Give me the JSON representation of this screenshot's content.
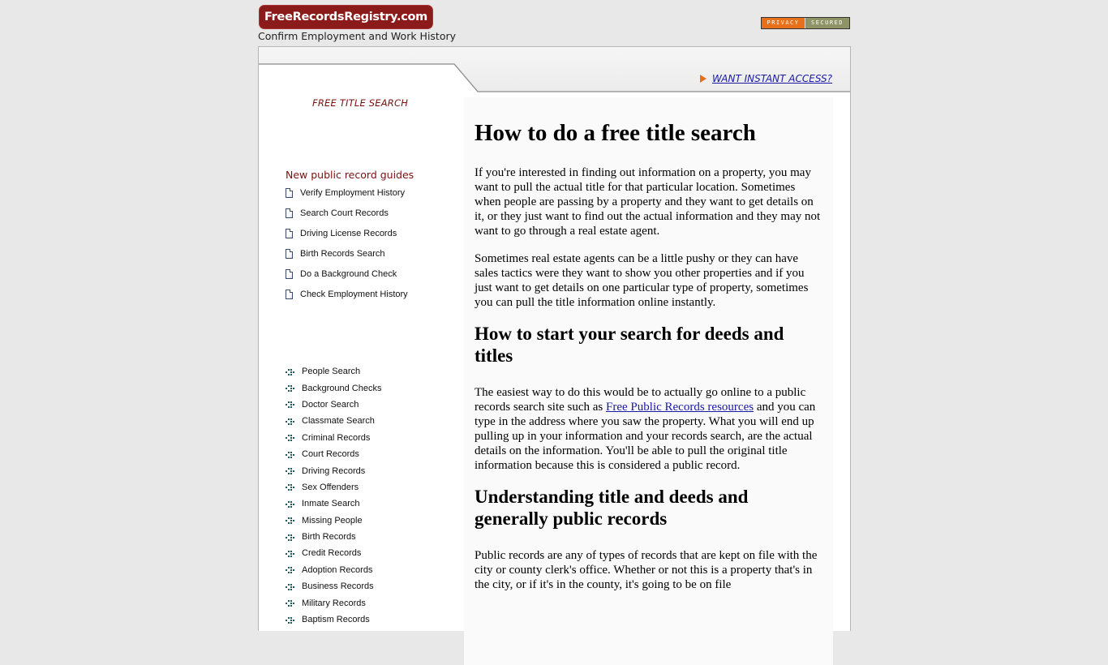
{
  "header": {
    "logo": "FreeRecordsRegistry.com",
    "tagline": "Confirm Employment and Work History",
    "badge_left": "PRIVACY",
    "badge_right": "SECURED"
  },
  "topbar": {
    "access_link": "WANT INSTANT ACCESS?"
  },
  "sidebar": {
    "title": "FREE TITLE SEARCH",
    "guides_title": "New public record guides",
    "guides": [
      {
        "label": "Verify Employment History",
        "icon": "document-icon"
      },
      {
        "label": "Search Court Records",
        "icon": "document-icon"
      },
      {
        "label": "Driving License Records",
        "icon": "document-icon"
      },
      {
        "label": "Birth Records Search",
        "icon": "document-icon"
      },
      {
        "label": "Do a Background Check",
        "icon": "document-icon"
      },
      {
        "label": "Check Employment History",
        "icon": "document-icon"
      }
    ],
    "links": [
      {
        "label": "People Search",
        "icon": "dotted-arrow-icon"
      },
      {
        "label": "Background Checks",
        "icon": "dotted-arrow-icon"
      },
      {
        "label": "Doctor Search",
        "icon": "dotted-arrow-icon"
      },
      {
        "label": "Classmate Search",
        "icon": "dotted-arrow-icon"
      },
      {
        "label": "Criminal Records",
        "icon": "dotted-arrow-icon"
      },
      {
        "label": "Court Records",
        "icon": "dotted-arrow-icon"
      },
      {
        "label": "Driving Records",
        "icon": "dotted-arrow-icon"
      },
      {
        "label": "Sex Offenders",
        "icon": "dotted-arrow-icon"
      },
      {
        "label": "Inmate Search",
        "icon": "dotted-arrow-icon"
      },
      {
        "label": "Missing People",
        "icon": "dotted-arrow-icon"
      },
      {
        "label": "Birth Records",
        "icon": "dotted-arrow-icon"
      },
      {
        "label": "Credit Records",
        "icon": "dotted-arrow-icon"
      },
      {
        "label": "Adoption Records",
        "icon": "dotted-arrow-icon"
      },
      {
        "label": "Business Records",
        "icon": "dotted-arrow-icon"
      },
      {
        "label": "Military Records",
        "icon": "dotted-arrow-icon"
      },
      {
        "label": "Baptism Records",
        "icon": "dotted-arrow-icon"
      }
    ]
  },
  "article": {
    "h1": "How to do a free title search",
    "p1": "If you're interested in finding out information on a property, you may want to pull the actual title for that particular location. Sometimes when people are passing by a property and they want to get details on it, or they just want to find out the actual information and they may not want to go through a real estate agent.",
    "p2": "Sometimes real estate agents can be a little pushy or they can have sales tactics were they want to show you other properties and if you just want to get details on one particular type of property, sometimes you can pull the title information online instantly.",
    "h2a": "How to start your search for deeds and titles",
    "p3_before": "The easiest way to do this would be to actually go online to a public records search site such as ",
    "p3_link": "Free Public Records resources",
    "p3_after": " and you can type in the address where you saw the property. What you will end up pulling up in your information and your records search, are the actual details on the information. You'll be able to pull the original title information because this is considered a public record.",
    "h2b": "Understanding title and deeds and generally public records",
    "p4": "Public records are any of types of records that are kept on file with the city or county clerk's office. Whether or not this is a property that's in the city, or if it's in the county, it's going to be on file"
  },
  "colors": {
    "brand": "#8b1b1b",
    "accent_orange": "#e8701a",
    "link": "#1a1aa6",
    "sidebar_heading": "#7a1010"
  }
}
